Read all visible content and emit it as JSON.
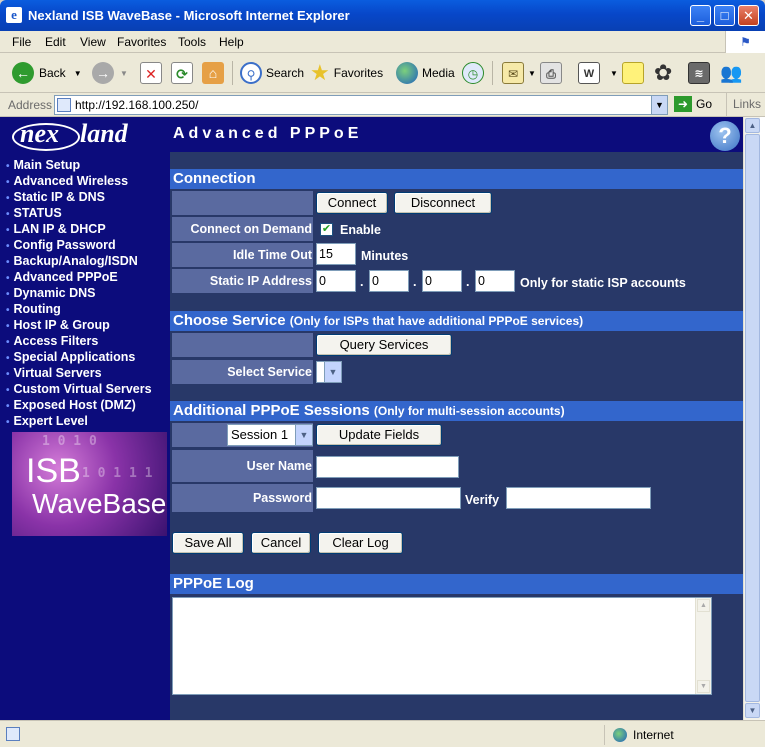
{
  "window": {
    "title": "Nexland ISB WaveBase - Microsoft Internet Explorer",
    "icon": "ie-icon",
    "controls": {
      "minimize": "_",
      "maximize": "□",
      "close": "✕"
    }
  },
  "menu": [
    "File",
    "Edit",
    "View",
    "Favorites",
    "Tools",
    "Help"
  ],
  "toolbar": {
    "back": "Back",
    "search": "Search",
    "favorites": "Favorites",
    "media": "Media"
  },
  "address": {
    "label": "Address",
    "url": "http://192.168.100.250/",
    "go": "Go",
    "links": "Links"
  },
  "sidebar": {
    "logo_part1": "nex",
    "logo_part2": "land",
    "items": [
      "Main Setup",
      "Advanced Wireless",
      "Static IP & DNS",
      "STATUS",
      "LAN IP & DHCP",
      "Config Password",
      "Backup/Analog/ISDN",
      "Advanced PPPoE",
      "Dynamic DNS",
      "Routing",
      "Host IP & Group",
      "Access Filters",
      "Special Applications",
      "Virtual Servers",
      "Custom Virtual Servers",
      "Exposed Host (DMZ)",
      "Expert Level"
    ],
    "active": "Advanced PPPoE",
    "banner": {
      "line1": "ISB",
      "line2": "WaveBase"
    }
  },
  "page": {
    "title": "Advanced PPPoE",
    "help": "?"
  },
  "connection": {
    "heading": "Connection",
    "connect": "Connect",
    "disconnect": "Disconnect",
    "connect_on_demand_label": "Connect on Demand",
    "enable_label": "Enable",
    "enable_checked": true,
    "idle_label": "Idle Time Out",
    "idle_value": "15",
    "idle_unit": "Minutes",
    "static_ip_label": "Static IP Address",
    "static_ip": [
      "0",
      "0",
      "0",
      "0"
    ],
    "ip_dot": ".",
    "static_note": "Only for static ISP accounts"
  },
  "service": {
    "heading": "Choose Service",
    "note": "(Only for ISPs that have additional PPPoE services)",
    "query": "Query Services",
    "select_label": "Select Service",
    "select_value": ""
  },
  "sessions": {
    "heading": "Additional PPPoE Sessions",
    "note": "(Only for multi-session accounts)",
    "session_value": "Session 1",
    "update": "Update Fields",
    "user_label": "User Name",
    "user_value": "",
    "password_label": "Password",
    "verify_label": "Verify"
  },
  "actions": {
    "save": "Save All",
    "cancel": "Cancel",
    "clear": "Clear Log"
  },
  "log": {
    "heading": "PPPoE Log",
    "content": ""
  },
  "status": {
    "zone": "Internet"
  }
}
